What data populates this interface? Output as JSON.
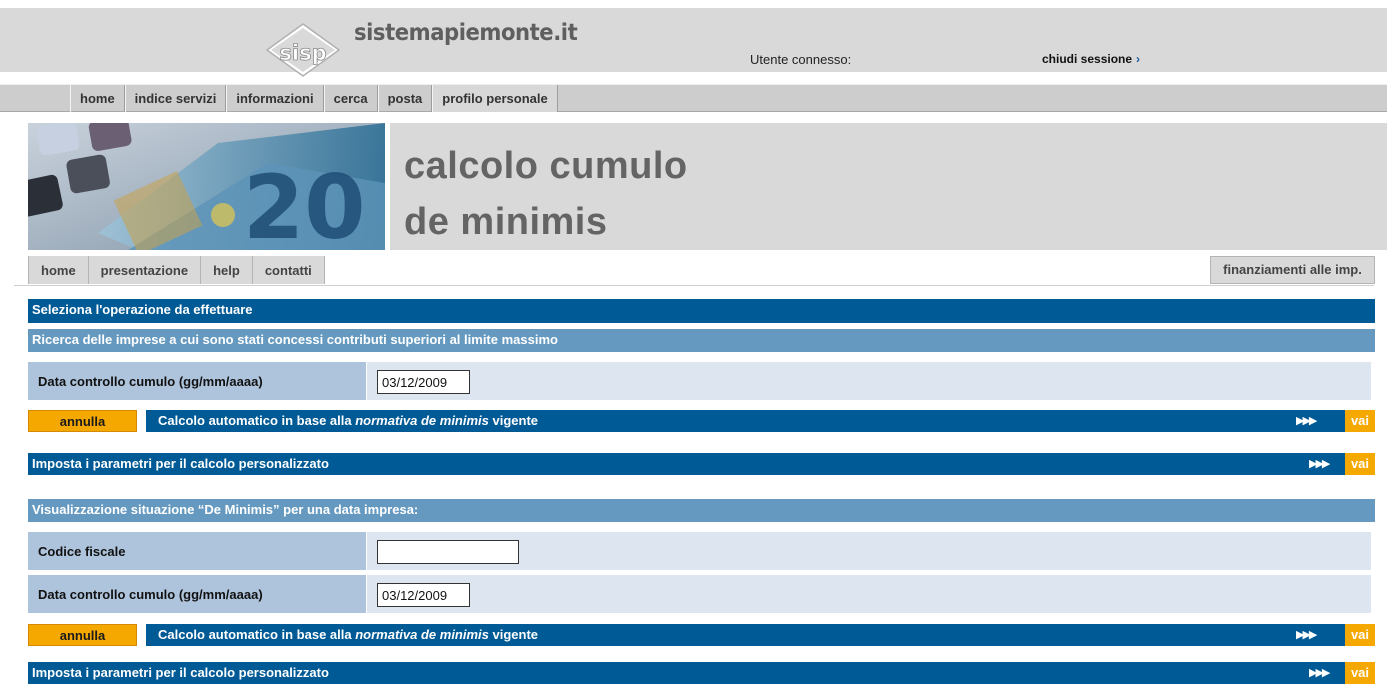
{
  "header": {
    "logo_text": "sisp",
    "brand": "sistemapiemonte.it",
    "user_label": "Utente connesso:",
    "logout_label": "chiudi sessione",
    "logout_arrow": "›"
  },
  "main_nav": {
    "items": [
      {
        "label": "home"
      },
      {
        "label": "indice servizi"
      },
      {
        "label": "informazioni"
      },
      {
        "label": "cerca"
      },
      {
        "label": "posta"
      },
      {
        "label": "profilo personale"
      }
    ]
  },
  "banner": {
    "title_line1": "calcolo cumulo",
    "title_line2": "de minimis"
  },
  "sub_nav": {
    "items": [
      {
        "label": "home"
      },
      {
        "label": "presentazione"
      },
      {
        "label": "help"
      },
      {
        "label": "contatti"
      }
    ],
    "right_label": "finanziamenti alle imp."
  },
  "section_header": "Seleziona l'operazione da effettuare",
  "search_block": {
    "title": "Ricerca delle imprese a cui sono stati concessi contributi superiori al limite massimo",
    "date_label": "Data controllo cumulo (gg/mm/aaaa)",
    "date_value": "03/12/2009",
    "cancel_label": "annulla",
    "auto_calc_prefix": "Calcolo automatico in base alla ",
    "auto_calc_em": "normativa de minimis",
    "auto_calc_suffix": " vigente",
    "custom_calc_label": "Imposta i parametri per il calcolo personalizzato",
    "go_arrows": "▶▶▶",
    "go_label": "vai"
  },
  "view_block": {
    "title": "Visualizzazione situazione “De Minimis” per una data impresa:",
    "tax_code_label": "Codice fiscale",
    "tax_code_value": "",
    "date_label": "Data controllo cumulo (gg/mm/aaaa)",
    "date_value": "03/12/2009",
    "cancel_label": "annulla",
    "auto_calc_prefix": "Calcolo automatico in base alla ",
    "auto_calc_em": "normativa de minimis",
    "auto_calc_suffix": " vigente",
    "custom_calc_label": "Imposta i parametri per il calcolo personalizzato",
    "go_arrows": "▶▶▶",
    "go_label": "vai"
  },
  "colors": {
    "dark_bar": "#005a96",
    "light_bar": "#6699c0",
    "label_cell": "#aec4dc",
    "row_bg": "#dde6f0",
    "accent_orange": "#f5a800",
    "header_gray": "#d9d9d9"
  }
}
